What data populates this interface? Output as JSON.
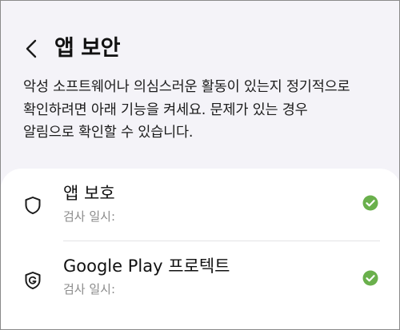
{
  "header": {
    "title": "앱 보안",
    "back_icon": "chevron-left-icon"
  },
  "description": {
    "lines": [
      "악성 소프트웨어나 의심스러운 활동이 있는지 정기적으로",
      "확인하려면 아래 기능을 켜세요. 문제가 있는 경우",
      "알림으로 확인할 수 있습니다."
    ]
  },
  "items": [
    {
      "label": "앱 보호",
      "sublabel": "검사 일시: ",
      "icon": "shield-icon",
      "status_icon": "check-circle-icon"
    },
    {
      "label": "Google Play 프로텍트",
      "sublabel": "검사 일시: ",
      "icon": "google-play-protect-icon",
      "status_icon": "check-circle-icon"
    }
  ],
  "colors": {
    "background": "#f4f3f8",
    "card": "#ffffff",
    "check": "#6ab04c",
    "subtext": "#8b8b8b"
  }
}
